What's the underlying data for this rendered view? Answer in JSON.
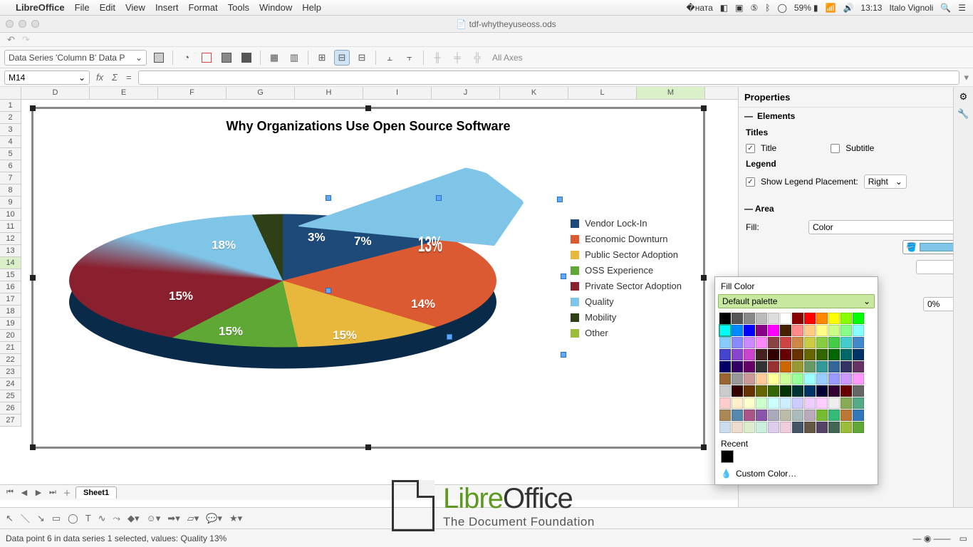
{
  "menubar": {
    "app_name": "LibreOffice",
    "items": [
      "File",
      "Edit",
      "View",
      "Insert",
      "Format",
      "Tools",
      "Window",
      "Help"
    ],
    "battery": "59%",
    "time": "13:13",
    "user": "Italo Vignoli"
  },
  "window": {
    "title": "tdf-whytheyuseoss.ods"
  },
  "chart_toolbar": {
    "selection": "Data Series 'Column B' Data P",
    "all_axes": "All Axes"
  },
  "formula_bar": {
    "cell_ref": "M14"
  },
  "columns": [
    "D",
    "E",
    "F",
    "G",
    "H",
    "I",
    "J",
    "K",
    "L",
    "M"
  ],
  "active_column": "M",
  "active_row": 14,
  "row_start": 1,
  "row_end": 27,
  "chart": {
    "title": "Why Organizations Use Open Source Software",
    "slices": [
      {
        "label": "Vendor Lock-In",
        "pct": "18%",
        "color": "#1e4a7a"
      },
      {
        "label": "Economic Downturn",
        "pct": "15%",
        "color": "#dc5a32"
      },
      {
        "label": "Public Sector Adoption",
        "pct": "15%",
        "color": "#e8b83c"
      },
      {
        "label": "OSS Experience",
        "pct": "15%",
        "color": "#5fa836"
      },
      {
        "label": "Private Sector Adoption",
        "pct": "14%",
        "color": "#8a1f2e"
      },
      {
        "label": "Quality",
        "pct": "13%",
        "color": "#7fc5e8"
      },
      {
        "label": "Mobility",
        "pct": "7%",
        "color": "#2f4016"
      },
      {
        "label": "Other",
        "pct": "3%",
        "color": "#9bbd3a"
      }
    ]
  },
  "sidebar": {
    "title": "Properties",
    "section_elements": "Elements",
    "titles_label": "Titles",
    "title_chk": "Title",
    "subtitle_chk": "Subtitle",
    "legend_label": "Legend",
    "show_legend": "Show Legend Placement:",
    "placement_value": "Right",
    "section_area": "Area",
    "fill_label": "Fill:",
    "fill_type": "Color",
    "transparency_value": "0%"
  },
  "color_popup": {
    "title": "Fill Color",
    "palette": "Default palette",
    "recent_label": "Recent",
    "custom_label": "Custom Color…"
  },
  "sheet_tabs": {
    "tab1": "Sheet1"
  },
  "status": {
    "text": "Data point 6 in data series 1 selected, values: Quality 13%"
  },
  "watermark": {
    "brand_a": "Libre",
    "brand_b": "Office",
    "sub": "The Document Foundation"
  },
  "chart_data": {
    "type": "pie",
    "title": "Why Organizations Use Open Source Software",
    "categories": [
      "Vendor Lock-In",
      "Economic Downturn",
      "Public Sector Adoption",
      "OSS Experience",
      "Private Sector Adoption",
      "Quality",
      "Mobility",
      "Other"
    ],
    "values": [
      18,
      15,
      15,
      15,
      14,
      13,
      7,
      3
    ],
    "colors": [
      "#1e4a7a",
      "#dc5a32",
      "#e8b83c",
      "#5fa836",
      "#8a1f2e",
      "#7fc5e8",
      "#2f4016",
      "#9bbd3a"
    ],
    "exploded_index": 5,
    "selected_index": 5,
    "three_d": true,
    "legend_position": "right"
  }
}
